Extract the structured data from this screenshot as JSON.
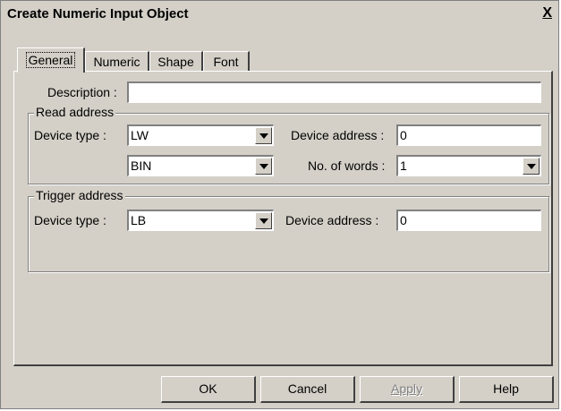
{
  "window": {
    "title": "Create Numeric Input Object",
    "close_label": "X"
  },
  "tabs": [
    {
      "label": "General",
      "active": true
    },
    {
      "label": "Numeric",
      "active": false
    },
    {
      "label": "Shape",
      "active": false
    },
    {
      "label": "Font",
      "active": false
    }
  ],
  "general": {
    "description_label": "Description :",
    "description_value": "",
    "read_address": {
      "title": "Read address",
      "device_type_label": "Device type :",
      "device_type_value": "LW",
      "format_value": "BIN",
      "device_address_label": "Device address :",
      "device_address_value": "0",
      "words_label": "No. of words :",
      "words_value": "1"
    },
    "trigger_address": {
      "title": "Trigger address",
      "device_type_label": "Device type :",
      "device_type_value": "LB",
      "device_address_label": "Device  address :",
      "device_address_value": "0"
    }
  },
  "buttons": {
    "ok": "OK",
    "cancel": "Cancel",
    "apply": "Apply",
    "help": "Help"
  }
}
